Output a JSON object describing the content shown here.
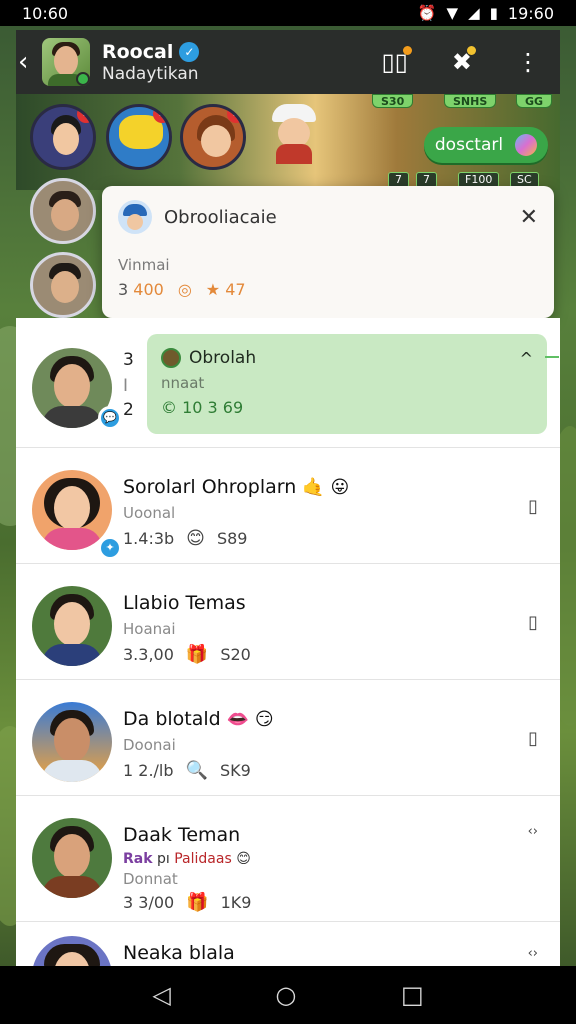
{
  "status_bar": {
    "time_left": "10:60",
    "time_right": "19:60",
    "icons": [
      "alarm-off-icon",
      "wifi-icon",
      "signal-icon",
      "battery-icon"
    ]
  },
  "header": {
    "title": "Roocal",
    "subtitle": "Nadaytikan",
    "back_icon": "chevron-left-icon",
    "actions": [
      "phone-book-icon",
      "crossed-tools-icon",
      "more-vertical-icon"
    ]
  },
  "game_strip": {
    "chips": [
      "S30",
      "SNHS",
      "GG"
    ],
    "button_label": "dosctarl",
    "stat_chips": [
      "7",
      "7",
      "F100",
      "SC"
    ]
  },
  "popup": {
    "title": "Obrooliacaie",
    "subtitle": "Vinmai",
    "count": "3",
    "value": "400",
    "rating": "★ 47"
  },
  "list": {
    "first": {
      "letter_top": "3",
      "letter_mid": "I",
      "letter_bottom": "2",
      "title": "Obrolah",
      "sub": "nnaat",
      "stat": "© 10 3 69"
    },
    "rows": [
      {
        "name": "Sorolarl Ohroplarn",
        "emoji": "🤙 😛",
        "sub": "Uoonal",
        "time": "1.4:3b",
        "meta_emoji": "😊",
        "meta_value": "S89"
      },
      {
        "name": "Llabio Temas",
        "emoji": "",
        "sub": "Hoanai",
        "time": "3.3,00",
        "meta_emoji": "🎁",
        "meta_value": "S20"
      },
      {
        "name": "Da blotald",
        "emoji": "👄 😏",
        "sub": "Doonai",
        "time": "1 2./lb",
        "meta_emoji": "🔍",
        "meta_value": "SK9"
      },
      {
        "name": "Daak Teman",
        "emoji": "",
        "sub": "Donnat",
        "time": "3 3/00",
        "meta_emoji": "🎁",
        "meta_value": "1K9",
        "rich_prefix": "Rak",
        "rich_mid": "pı",
        "rich_red": "Palidaas"
      },
      {
        "name": "Neaka blala",
        "emoji": "",
        "sub": "",
        "time": "",
        "meta_emoji": "",
        "meta_value": ""
      }
    ]
  },
  "colors": {
    "accent_green": "#3aa648",
    "highlight": "#c9e9c3",
    "verified_blue": "#2d9de0"
  }
}
